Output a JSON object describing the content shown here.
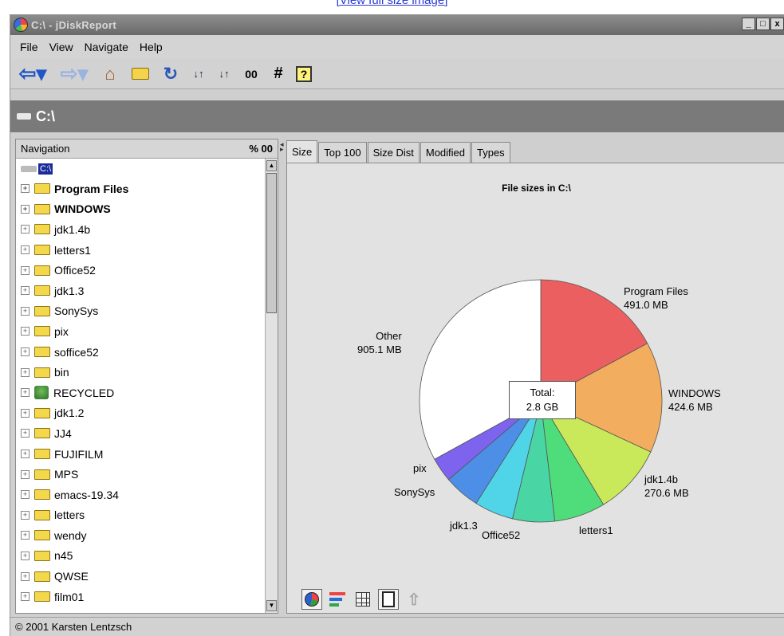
{
  "top_link": {
    "text": "[View full size image]"
  },
  "window": {
    "title": "C:\\ - jDiskReport",
    "controls": [
      "_",
      "□",
      "x"
    ]
  },
  "menu": [
    "File",
    "View",
    "Navigate",
    "Help"
  ],
  "toolbar": {
    "icons": [
      "back-icon",
      "forward-icon",
      "home-icon",
      "folder-icon",
      "refresh-icon",
      "sort-ascending-icon",
      "sort-descending-icon",
      "view-icon",
      "count-icon",
      "help-icon"
    ],
    "sort_asc": "↓↑",
    "sort_desc": "↓↑",
    "view_glyph": "00",
    "hash_glyph": "#",
    "help_glyph": "?"
  },
  "path": {
    "label": "C:\\"
  },
  "navigation": {
    "header": "Navigation",
    "header_right": "% 00",
    "root": "C:\\",
    "items": [
      {
        "label": "Program Files",
        "bold": true,
        "icon": "folder"
      },
      {
        "label": "WINDOWS",
        "bold": true,
        "icon": "folder"
      },
      {
        "label": "jdk1.4b",
        "bold": false,
        "icon": "folder"
      },
      {
        "label": "letters1",
        "bold": false,
        "icon": "folder"
      },
      {
        "label": "Office52",
        "bold": false,
        "icon": "folder"
      },
      {
        "label": "jdk1.3",
        "bold": false,
        "icon": "folder"
      },
      {
        "label": "SonySys",
        "bold": false,
        "icon": "folder"
      },
      {
        "label": "pix",
        "bold": false,
        "icon": "folder"
      },
      {
        "label": "soffice52",
        "bold": false,
        "icon": "folder"
      },
      {
        "label": "bin",
        "bold": false,
        "icon": "folder"
      },
      {
        "label": "RECYCLED",
        "bold": false,
        "icon": "recycle"
      },
      {
        "label": "jdk1.2",
        "bold": false,
        "icon": "folder"
      },
      {
        "label": "JJ4",
        "bold": false,
        "icon": "folder"
      },
      {
        "label": "FUJIFILM",
        "bold": false,
        "icon": "folder"
      },
      {
        "label": "MPS",
        "bold": false,
        "icon": "folder"
      },
      {
        "label": "emacs-19.34",
        "bold": false,
        "icon": "folder"
      },
      {
        "label": "letters",
        "bold": false,
        "icon": "folder"
      },
      {
        "label": "wendy",
        "bold": false,
        "icon": "folder"
      },
      {
        "label": "n45",
        "bold": false,
        "icon": "folder"
      },
      {
        "label": "QWSE",
        "bold": false,
        "icon": "folder"
      },
      {
        "label": "film01",
        "bold": false,
        "icon": "folder"
      }
    ]
  },
  "tabs": [
    "Size",
    "Top 100",
    "Size Dist",
    "Modified",
    "Types"
  ],
  "active_tab": "Size",
  "chart_data": {
    "type": "pie",
    "title": "File sizes in C:\\",
    "center_label": [
      "Total:",
      "2.8 GB"
    ],
    "slices": [
      {
        "name": "Program Files",
        "value_label": "491.0 MB",
        "fraction": 0.1712,
        "color": "#ec5f60"
      },
      {
        "name": "WINDOWS",
        "value_label": "424.6 MB",
        "fraction": 0.148,
        "color": "#f2ad5e"
      },
      {
        "name": "jdk1.4b",
        "value_label": "270.6 MB",
        "fraction": 0.0943,
        "color": "#c9e85a"
      },
      {
        "name": "letters1",
        "value_label": "",
        "fraction": 0.068,
        "color": "#4fdc7a"
      },
      {
        "name": "Office52",
        "value_label": "",
        "fraction": 0.056,
        "color": "#49d6a4"
      },
      {
        "name": "jdk1.3",
        "value_label": "",
        "fraction": 0.052,
        "color": "#4fd4e8"
      },
      {
        "name": "SonySys",
        "value_label": "",
        "fraction": 0.048,
        "color": "#4d8fe6"
      },
      {
        "name": "pix",
        "value_label": "",
        "fraction": 0.0325,
        "color": "#7d63ee"
      },
      {
        "name": "Other",
        "value_label": "905.1 MB",
        "fraction": 0.33,
        "color": "#ffffff"
      }
    ]
  },
  "bottom_tools": [
    "pie-chart-icon",
    "bar-chart-icon",
    "table-icon",
    "page-icon",
    "up-icon"
  ],
  "status": {
    "text": "© 2001 Karsten Lentzsch"
  }
}
